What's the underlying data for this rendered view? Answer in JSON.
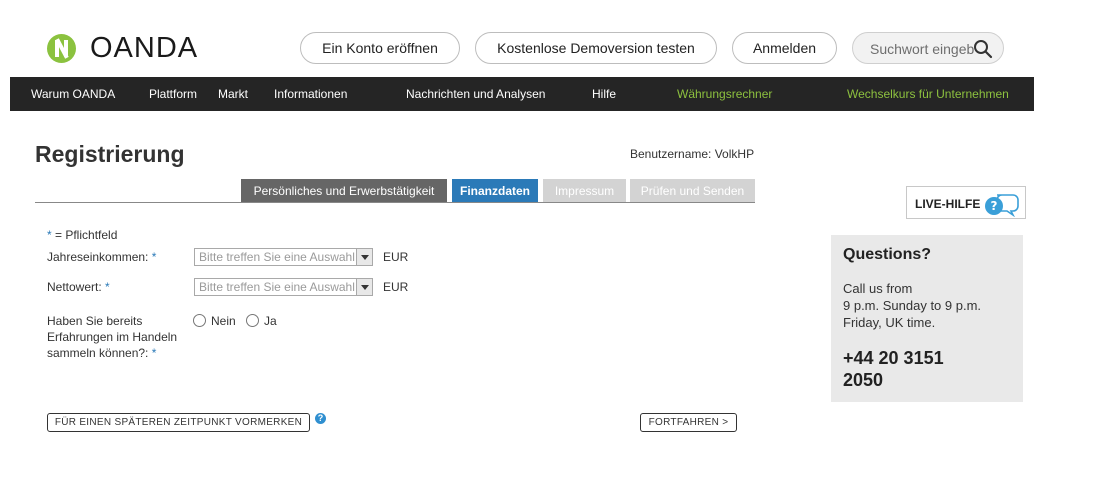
{
  "brand": {
    "name": "OANDA",
    "color": "#8bc23f"
  },
  "header": {
    "open_account": "Ein Konto eröffnen",
    "demo": "Kostenlose Demoversion testen",
    "login": "Anmelden",
    "search_placeholder": "Suchwort eingeb",
    "search_icon": "search-icon"
  },
  "nav": {
    "items": [
      "Warum OANDA",
      "Plattform",
      "Markt",
      "Informationen",
      "Nachrichten und Analysen",
      "Hilfe",
      "Währungsrechner",
      "Wechselkurs für Unternehmen"
    ],
    "highlight_color": "#8dc13f",
    "background": "#252525"
  },
  "page": {
    "title": "Registrierung",
    "username_label": "Benutzername: VolkHP"
  },
  "steps": [
    {
      "label": "Persönliches und Erwerbstätigkeit",
      "state": "completed",
      "color": "#666666"
    },
    {
      "label": "Finanzdaten",
      "state": "active",
      "color": "#2b7ab8"
    },
    {
      "label": "Impressum",
      "state": "pending",
      "color": "#d3d3d3"
    },
    {
      "label": "Prüfen und Senden",
      "state": "pending",
      "color": "#d3d3d3"
    }
  ],
  "form": {
    "required_star": "*",
    "required_note": " = Pflichtfeld",
    "annual_income": {
      "label": "Jahreseinkommen: ",
      "star": "*",
      "placeholder": "Bitte treffen Sie eine Auswahl",
      "currency": "EUR"
    },
    "net_worth": {
      "label": "Nettowert: ",
      "star": "*",
      "placeholder": "Bitte treffen Sie eine Auswahl",
      "currency": "EUR"
    },
    "experience": {
      "label_line1": "Haben Sie bereits",
      "label_line2": "Erfahrungen im Handeln",
      "label_line3": "sammeln können?: ",
      "star": "*",
      "option_no": "Nein",
      "option_yes": "Ja"
    },
    "save_later": "FÜR EINEN SPÄTEREN ZEITPUNKT VORMERKEN",
    "help_glyph": "?",
    "continue": "FORTFAHREN >"
  },
  "sidebar": {
    "live_help": "LIVE-HILFE",
    "questions_title": "Questions?",
    "call_line1": "Call us from",
    "call_line2": "9 p.m. Sunday to 9 p.m.",
    "call_line3": "Friday, UK time.",
    "phone_line1": "+44 20 3151",
    "phone_line2": "2050"
  }
}
